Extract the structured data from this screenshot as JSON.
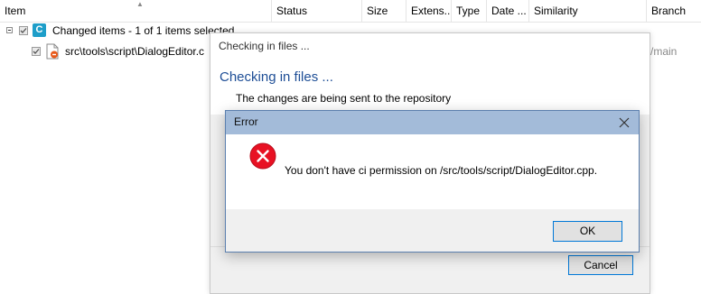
{
  "table": {
    "columns": [
      "Item",
      "Status",
      "Size",
      "Extens...",
      "Type",
      "Date ...",
      "Similarity",
      "Branch"
    ],
    "sort_indicator": "▲",
    "group_row": {
      "badge": "C",
      "label": "Changed items - 1 of 1 items selected"
    },
    "file_row": {
      "path": "src\\tools\\script\\DialogEditor.c",
      "branch": "/main"
    }
  },
  "progress_dialog": {
    "title": "Checking in files ...",
    "heading": "Checking in files ...",
    "message": "The changes are being sent to the repository",
    "cancel_label": "Cancel"
  },
  "error_dialog": {
    "title": "Error",
    "message": "You don't have ci permission on /src/tools/script/DialogEditor.cpp.",
    "ok_label": "OK",
    "icon": "error-icon",
    "close_icon": "close-icon"
  },
  "colors": {
    "error_red": "#e81123",
    "accent_blue": "#0078d7",
    "heading_blue": "#1e4e96",
    "titlebar": "#a3bbd9",
    "badge": "#1e9ec9"
  }
}
